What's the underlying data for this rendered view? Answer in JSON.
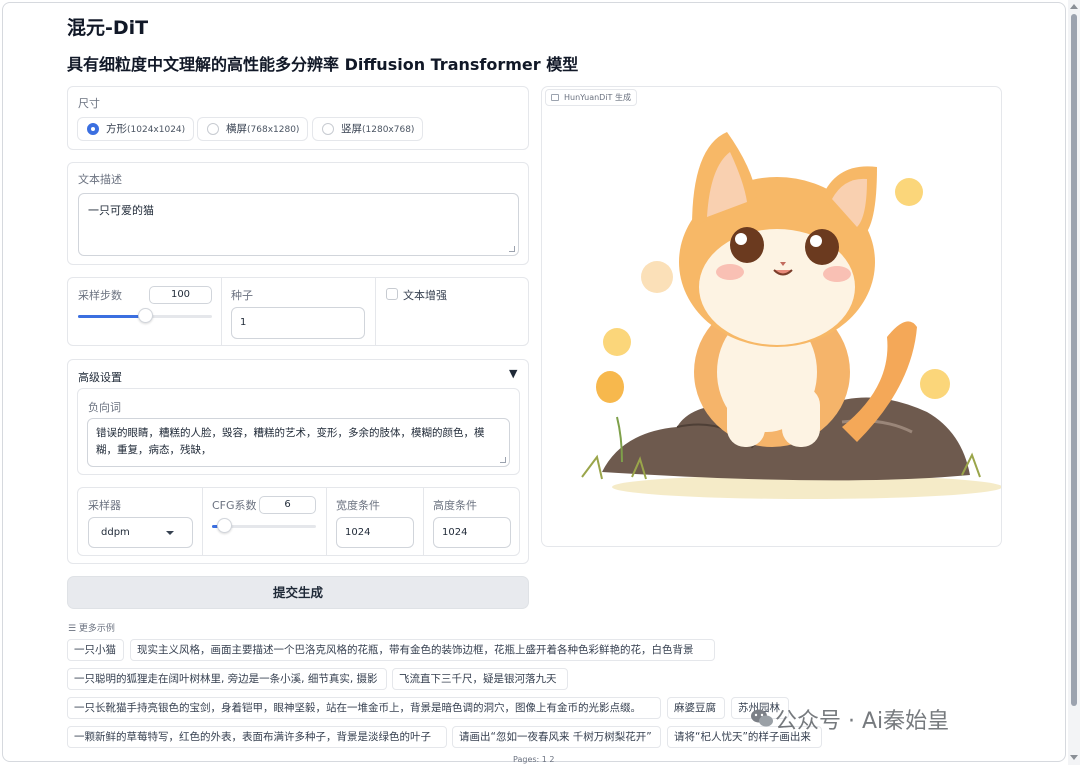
{
  "header": {
    "title": "混元-DiT",
    "subtitle": "具有细粒度中文理解的高性能多分辨率 Diffusion Transformer 模型"
  },
  "size": {
    "label": "尺寸",
    "options": [
      {
        "name": "方形",
        "dims": "(1024x1024)",
        "selected": true
      },
      {
        "name": "横屏",
        "dims": "(768x1280)",
        "selected": false
      },
      {
        "name": "竖屏",
        "dims": "(1280x768)",
        "selected": false
      }
    ]
  },
  "prompt": {
    "label": "文本描述",
    "value": "一只可爱的猫"
  },
  "params": {
    "steps_label": "采样步数",
    "steps_value": "100",
    "steps_fraction": 0.5,
    "seed_label": "种子",
    "seed_value": "1",
    "enhance_label": "文本增强",
    "enhance_checked": false
  },
  "advanced": {
    "label": "高级设置",
    "toggle_glyph": "▼",
    "negative_label": "负向词",
    "negative_value": "错误的眼睛，糟糕的人脸，毁容，糟糕的艺术，变形，多余的肢体，模糊的颜色，模糊，重复，病态，残缺，",
    "sampler_label": "采样器",
    "sampler_value": "ddpm",
    "cfg_label": "CFG系数",
    "cfg_value": "6",
    "cfg_fraction": 0.12,
    "width_label": "宽度条件",
    "width_value": "1024",
    "height_label": "高度条件",
    "height_value": "1024"
  },
  "submit_label": "提交生成",
  "output": {
    "tag": "HunYuanDiT 生成"
  },
  "examples": {
    "title": "☰ 更多示例",
    "items": [
      "一只小猫",
      "现实主义风格，画面主要描述一个巴洛克风格的花瓶，带有金色的装饰边框，花瓶上盛开着各种色彩鲜艳的花，白色背景",
      "一只聪明的狐狸走在阔叶树林里, 旁边是一条小溪, 细节真实, 摄影",
      "飞流直下三千尺，疑是银河落九天",
      "一只长靴猫手持亮银色的宝剑，身着铠甲，眼神坚毅，站在一堆金币上，背景是暗色调的洞穴，图像上有金币的光影点缀。",
      "麻婆豆腐",
      "苏州园林",
      "一颗新鲜的草莓特写，红色的外表，表面布满许多种子，背景是淡绿色的叶子",
      "请画出“忽如一夜春风来 千树万树梨花开”",
      "请将“杞人忧天”的样子画出来"
    ],
    "pages": "Pages: 1 2"
  },
  "watermark": "公众号 · Ai秦始皇",
  "colors": {
    "accent": "#3b6fe0",
    "panel_border": "#e5e7eb",
    "button_bg": "#e8eaee"
  }
}
